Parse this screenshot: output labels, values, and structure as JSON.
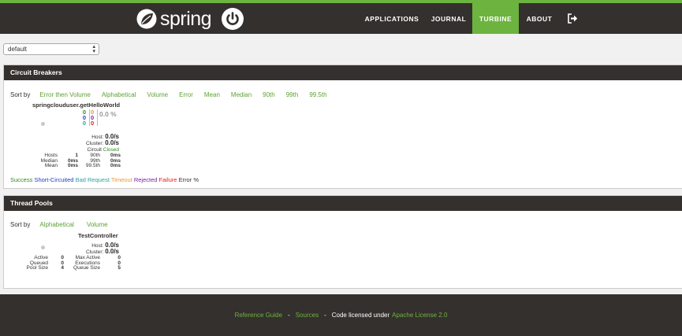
{
  "brand": {
    "name": "spring"
  },
  "nav": {
    "items": [
      {
        "label": "APPLICATIONS"
      },
      {
        "label": "JOURNAL"
      },
      {
        "label": "TURBINE"
      },
      {
        "label": "ABOUT"
      }
    ],
    "logout_icon": "logout-icon"
  },
  "stream_select": {
    "value": "default"
  },
  "colors": {
    "accent": "#6db33f",
    "dark": "#34302d",
    "success": "#2e8b1e",
    "short_circuited": "#1f3ec8",
    "bad_request": "#28a39b",
    "timeout": "#e9962d",
    "rejected": "#7a1fa2",
    "failure": "#e0201c"
  },
  "circuit_breakers": {
    "title": "Circuit Breakers",
    "sort_label": "Sort by",
    "sort_options": [
      "Error then Volume",
      "Alphabetical",
      "Volume",
      "Error",
      "Mean",
      "Median",
      "90th",
      "99th",
      "99.5th"
    ],
    "circuit": {
      "name": "springclouduser.getHelloWorld",
      "counts_left": [
        "0",
        "0",
        "0"
      ],
      "counts_right": [
        "0",
        "0",
        "0"
      ],
      "error_pct": "0.0 %",
      "host_label": "Host:",
      "host_rate": "0.0/s",
      "cluster_label": "Cluster:",
      "cluster_rate": "0.0/s",
      "status_prefix": "Circuit",
      "status": "Closed",
      "stats": {
        "hosts_label": "Hosts",
        "hosts": "1",
        "median_label": "Median",
        "median": "0ms",
        "mean_label": "Mean",
        "mean": "0ms",
        "p90_label": "90th",
        "p90": "0ms",
        "p99_label": "99th",
        "p99": "0ms",
        "p995_label": "99.5th",
        "p995": "0ms"
      }
    },
    "legend": {
      "success": "Success",
      "short_circuited": "Short-Circuited",
      "bad_request": "Bad Request",
      "timeout": "Timeout",
      "rejected": "Rejected",
      "failure": "Failure",
      "error_pct": "Error %"
    }
  },
  "thread_pools": {
    "title": "Thread Pools",
    "sort_label": "Sort by",
    "sort_options": [
      "Alphabetical",
      "Volume"
    ],
    "pool": {
      "name": "TestController",
      "host_label": "Host:",
      "host_rate": "0.0/s",
      "cluster_label": "Cluster:",
      "cluster_rate": "0.0/s",
      "stats": {
        "active_label": "Active",
        "active": "0",
        "queued_label": "Queued",
        "queued": "0",
        "pool_size_label": "Pool Size",
        "pool_size": "4",
        "max_active_label": "Max Active",
        "max_active": "0",
        "executions_label": "Executions",
        "executions": "0",
        "queue_size_label": "Queue Size",
        "queue_size": "5"
      }
    }
  },
  "footer": {
    "reference_guide": "Reference Guide",
    "separator": "-",
    "sources": "Sources",
    "license_text": "Code licensed under",
    "license_link": "Apache License 2.0"
  }
}
